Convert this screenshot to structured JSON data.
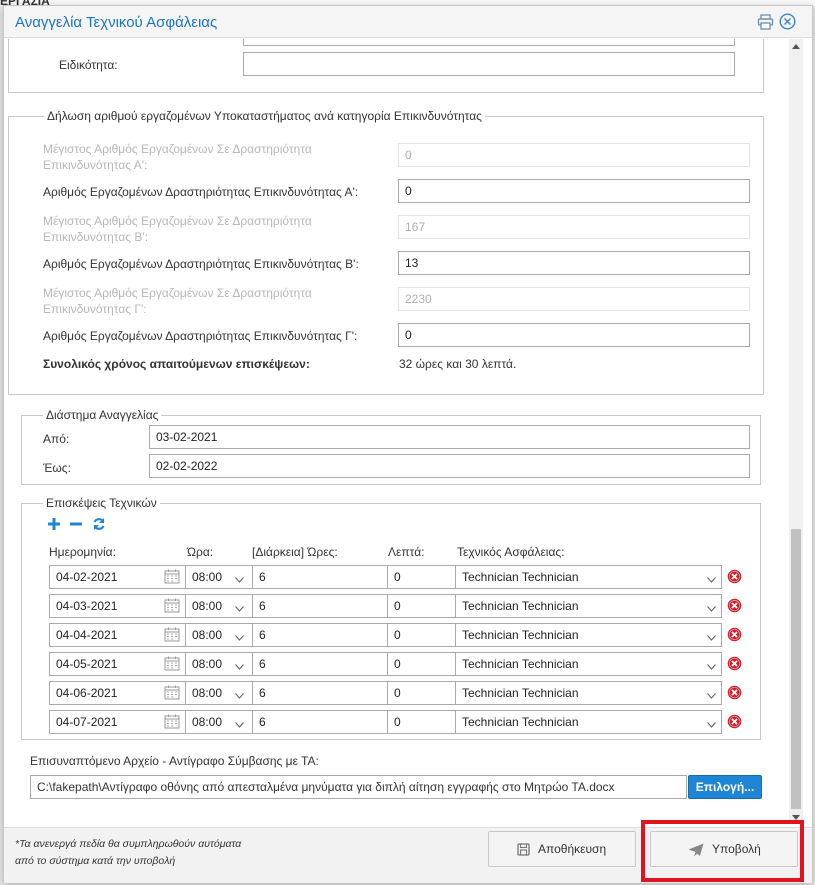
{
  "background": {
    "partial_text": "ΕΡΓΑΣΙΑ"
  },
  "dialog": {
    "title": "Αναγγελία Τεχνικού Ασφάλειας",
    "speciality_label": "Ειδικότητα:",
    "speciality_value": ""
  },
  "employees": {
    "legend": "Δήλωση αριθμού εργαζομένων Υποκαταστήματος ανά κατηγορία Επικινδυνότητας",
    "max_a_label_line1": "Μέγιστος Αριθμός Εργαζομένων Σε Δραστηριότητα",
    "max_a_label_line2": "Επικινδυνότητας Α':",
    "max_a_value": "0",
    "count_a_label": "Αριθμός Εργαζομένων Δραστηριότητας Επικινδυνότητας Α':",
    "count_a_value": "0",
    "max_b_label_line1": "Μέγιστος Αριθμός Εργαζομένων Σε Δραστηριότητα",
    "max_b_label_line2": "Επικινδυνότητας Β':",
    "max_b_value": "167",
    "count_b_label": "Αριθμός Εργαζομένων Δραστηριότητας Επικινδυνότητας Β':",
    "count_b_value": "13",
    "max_c_label_line1": "Μέγιστος Αριθμός Εργαζομένων Σε Δραστηριότητα",
    "max_c_label_line2": "Επικινδυνότητας Γ':",
    "max_c_value": "2230",
    "count_c_label": "Αριθμός Εργαζομένων Δραστηριότητας Επικινδυνότητας Γ':",
    "count_c_value": "0",
    "total_label": "Συνολικός χρόνος απαιτούμενων επισκέψεων:",
    "total_value": "32 ώρες και 30 λεπτά."
  },
  "period": {
    "legend": "Διάστημα Αναγγελίας",
    "from_label": "Από:",
    "from_value": "03-02-2021",
    "to_label": "Έως:",
    "to_value": "02-02-2022"
  },
  "visits": {
    "legend": "Επισκέψεις Τεχνικών",
    "headers": {
      "date": "Ημερομηνία:",
      "time": "Ώρα:",
      "hours": "[Διάρκεια] Ώρες:",
      "minutes": "Λεπτά:",
      "technician": "Τεχνικός Ασφάλειας:"
    },
    "rows": [
      {
        "date": "04-02-2021",
        "time": "08:00",
        "hours": "6",
        "minutes": "0",
        "technician": "Technician Technician"
      },
      {
        "date": "04-03-2021",
        "time": "08:00",
        "hours": "6",
        "minutes": "0",
        "technician": "Technician Technician"
      },
      {
        "date": "04-04-2021",
        "time": "08:00",
        "hours": "6",
        "minutes": "0",
        "technician": "Technician Technician"
      },
      {
        "date": "04-05-2021",
        "time": "08:00",
        "hours": "6",
        "minutes": "0",
        "technician": "Technician Technician"
      },
      {
        "date": "04-06-2021",
        "time": "08:00",
        "hours": "6",
        "minutes": "0",
        "technician": "Technician Technician"
      },
      {
        "date": "04-07-2021",
        "time": "08:00",
        "hours": "6",
        "minutes": "0",
        "technician": "Technician Technician"
      }
    ]
  },
  "attachment": {
    "label": "Επισυναπτόμενο Αρχείο - Αντίγραφο Σύμβασης με ΤΑ:",
    "value": "C:\\fakepath\\Αντίγραφο οθόνης από απεσταλμένα μηνύματα για διπλή αίτηση εγγραφής στο Μητρώο ΤΑ.docx",
    "button": "Επιλογή..."
  },
  "footer": {
    "note_line1": "*Τα ανενεργά πεδία θα συμπληρωθούν αυτόματα",
    "note_line2": "από το σύστημα κατά την υποβολή",
    "save": "Αποθήκευση",
    "submit": "Υποβολή"
  },
  "colors": {
    "accent": "#1f86d6",
    "title": "#1b74c4",
    "highlight": "#e0141f",
    "delete": "#d0202c"
  },
  "icons": [
    "print-icon",
    "close-icon",
    "add-icon",
    "remove-icon",
    "refresh-icon",
    "calendar-icon",
    "chevron-down-icon",
    "delete-row-icon",
    "save-icon",
    "send-icon"
  ]
}
